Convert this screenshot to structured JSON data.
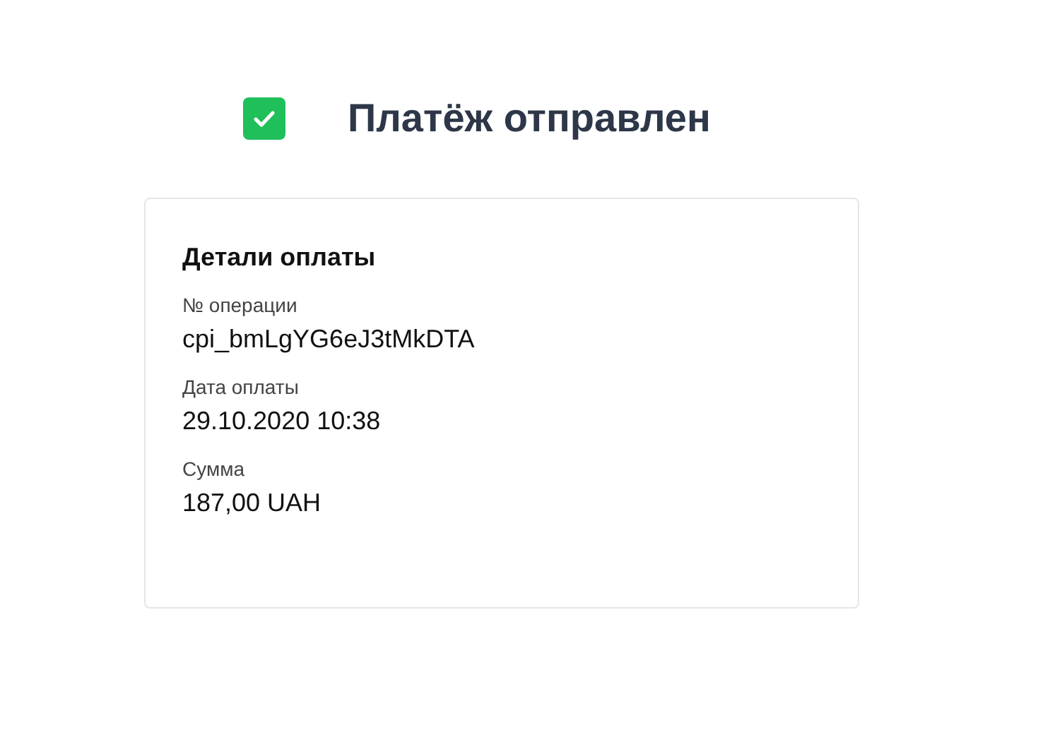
{
  "status": {
    "title": "Платёж отправлен",
    "success": true
  },
  "card": {
    "title": "Детали оплаты",
    "fields": [
      {
        "label": "№ операции",
        "value": "cpi_bmLgYG6eJ3tMkDTA"
      },
      {
        "label": "Дата оплаты",
        "value": "29.10.2020 10:38"
      },
      {
        "label": "Сумма",
        "value": "187,00 UAH"
      }
    ]
  }
}
